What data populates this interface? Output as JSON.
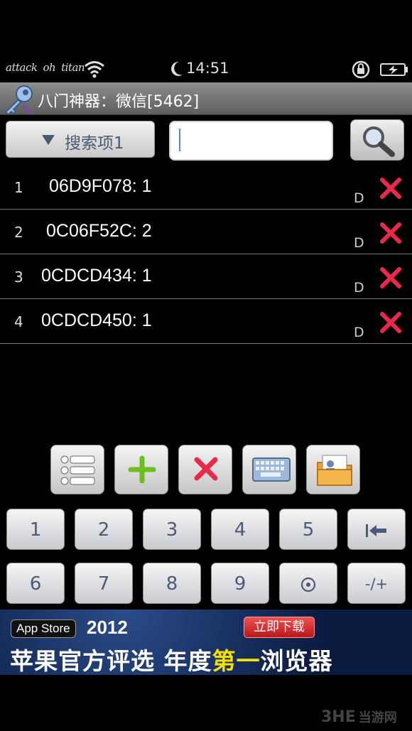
{
  "status_bar": {
    "carriers": [
      "attack",
      "oh",
      "titan"
    ],
    "time": "14:51"
  },
  "title_bar": {
    "title": "八门神器：微信[5462]"
  },
  "search": {
    "type_label": "搜索项1",
    "input_value": "",
    "button_icon": "magnifier-icon"
  },
  "results": [
    {
      "index": "1",
      "address": "06D9F078: 1",
      "type": "D"
    },
    {
      "index": "2",
      "address": "0C06F52C: 2",
      "type": "D"
    },
    {
      "index": "3",
      "address": "0CDCD434: 1",
      "type": "D"
    },
    {
      "index": "4",
      "address": "0CDCD450: 1",
      "type": "D"
    }
  ],
  "toolbar": {
    "icons": [
      "list-icon",
      "add-icon",
      "delete-icon",
      "keyboard-icon",
      "folder-icon"
    ]
  },
  "keypad": {
    "row1": [
      "1",
      "2",
      "3",
      "4",
      "5"
    ],
    "row2": [
      "6",
      "7",
      "8",
      "9"
    ]
  },
  "ad": {
    "badge": "App Store",
    "year": "2012",
    "button": "立即下载",
    "slogan_a": "苹果官方评选  年度",
    "slogan_b": "第一",
    "slogan_c": "浏览器"
  },
  "watermark": {
    "logo": "3HE",
    "text": "当游网"
  },
  "colors": {
    "accent_red": "#e8294a",
    "key_text": "#4b5a78",
    "add_green": "#6dbd1e"
  }
}
